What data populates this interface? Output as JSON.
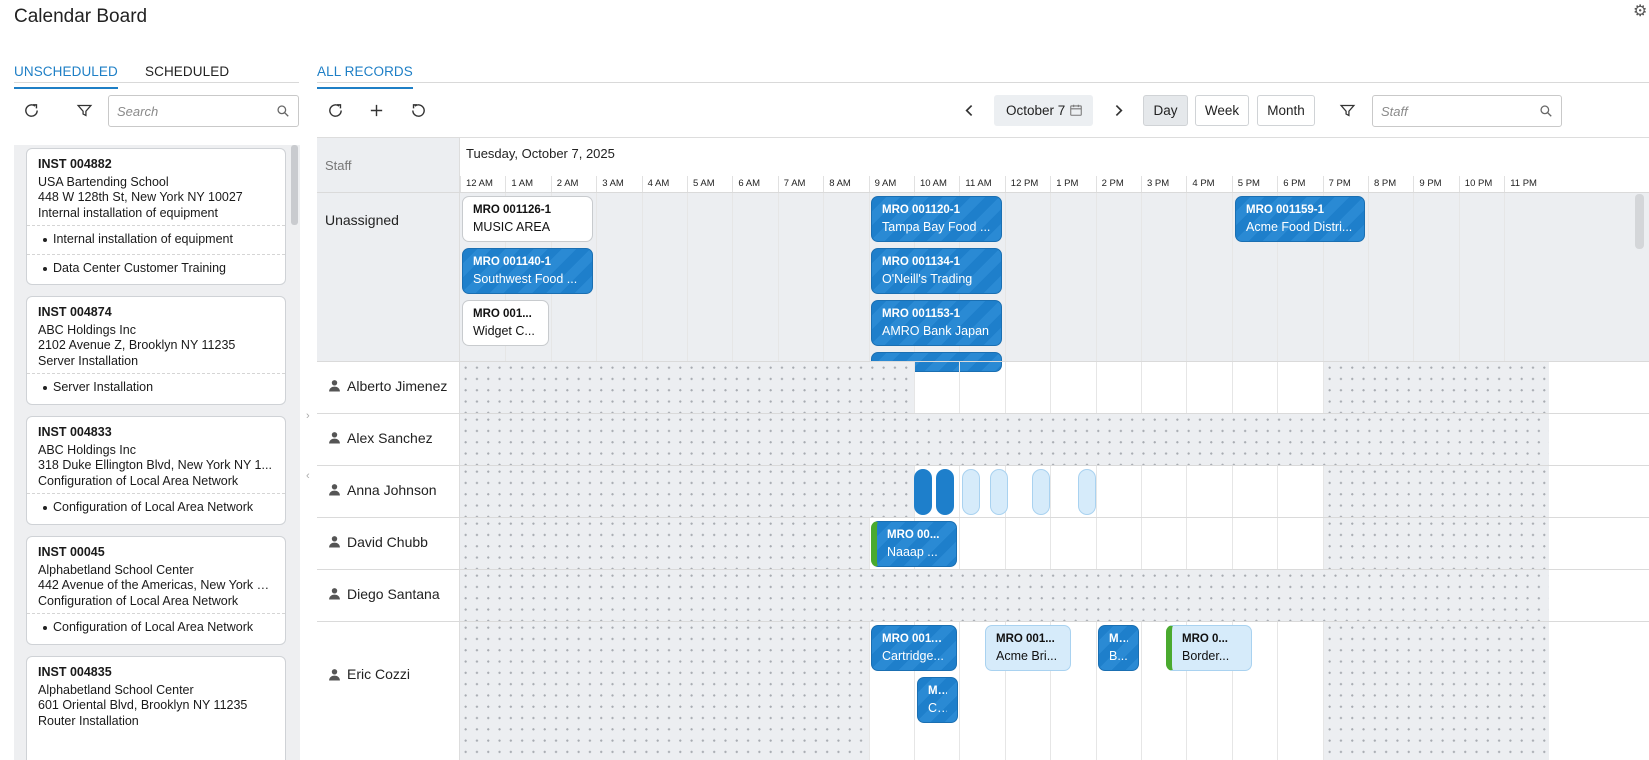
{
  "app": {
    "title": "Calendar Board"
  },
  "left": {
    "tabs": [
      {
        "label": "UNSCHEDULED"
      },
      {
        "label": "SCHEDULED"
      }
    ],
    "search_placeholder": "Search",
    "cards": [
      {
        "id": "INST 004882",
        "lines": [
          "USA Bartending School",
          "448 W 128th St, New York NY 10027",
          "Internal installation of equipment"
        ],
        "bullets": [
          "Internal installation of equipment",
          "Data Center Customer Training"
        ]
      },
      {
        "id": "INST 004874",
        "lines": [
          "ABC Holdings Inc",
          "2102 Avenue Z, Brooklyn NY 11235",
          "Server Installation"
        ],
        "bullets": [
          "Server Installation"
        ]
      },
      {
        "id": "INST 004833",
        "lines": [
          "ABC Holdings Inc",
          "318 Duke Ellington Blvd, New York NY 1...",
          "Configuration of Local Area Network"
        ],
        "bullets": [
          "Configuration of Local Area Network"
        ]
      },
      {
        "id": "INST 00045",
        "lines": [
          "Alphabetland School Center",
          "442 Avenue of the Americas, New York N...",
          "Configuration of Local Area Network"
        ],
        "bullets": [
          "Configuration of Local Area Network"
        ]
      },
      {
        "id": "INST 004835",
        "lines": [
          "Alphabetland School Center",
          "601 Oriental Blvd, Brooklyn NY 11235",
          "Router Installation"
        ],
        "bullets": []
      }
    ]
  },
  "right": {
    "tabs": [
      {
        "label": "ALL RECORDS"
      }
    ],
    "date_label": "October 7",
    "views": [
      {
        "label": "Day"
      },
      {
        "label": "Week"
      },
      {
        "label": "Month"
      }
    ],
    "staff_placeholder": "Staff",
    "staff_header": "Staff",
    "day_title": "Tuesday, October 7, 2025",
    "hours": [
      "12 AM",
      "1 AM",
      "2 AM",
      "3 AM",
      "4 AM",
      "5 AM",
      "6 AM",
      "7 AM",
      "8 AM",
      "9 AM",
      "10 AM",
      "11 AM",
      "12 PM",
      "1 PM",
      "2 PM",
      "3 PM",
      "4 PM",
      "5 PM",
      "6 PM",
      "7 PM",
      "8 PM",
      "9 PM",
      "10 PM",
      "11 PM"
    ],
    "rows": [
      {
        "name": "Unassigned"
      },
      {
        "name": "Alberto Jimenez"
      },
      {
        "name": "Alex Sanchez"
      },
      {
        "name": "Anna Johnson"
      },
      {
        "name": "David Chubb"
      },
      {
        "name": "Diego Santana"
      },
      {
        "name": "Eric Cozzi"
      }
    ],
    "events": {
      "u1": {
        "a": "MRO 001126-1",
        "b": "MUSIC AREA"
      },
      "u2": {
        "a": "MRO 001140-1",
        "b": "Southwest Food ..."
      },
      "u3": {
        "a": "MRO 001...",
        "b": "Widget C..."
      },
      "u4": {
        "a": "MRO 001120-1",
        "b": "Tampa Bay Food ..."
      },
      "u5": {
        "a": "MRO 001134-1",
        "b": "O'Neill's Trading"
      },
      "u6": {
        "a": "MRO 001153-1",
        "b": "AMRO Bank Japan"
      },
      "u7": {
        "a": "MRO 001159-1",
        "b": "Acme Food Distri..."
      },
      "d1": {
        "a": "MRO 00...",
        "b": "Naaap ..."
      },
      "e1": {
        "a": "MRO 0011...",
        "b": "Cartridge..."
      },
      "e2": {
        "a": "MRO 001...",
        "b": "Acme Bri..."
      },
      "e3": {
        "a": "M...",
        "b": "B..."
      },
      "e4": {
        "a": "MRO 0...",
        "b": "Border..."
      },
      "e5": {
        "a": "M...",
        "b": "C..."
      }
    }
  },
  "colors": {
    "accent": "#1e7fc6",
    "event_blue": "#1e7fcb",
    "event_light": "#d6ebfa",
    "green_marker": "#4aaa2f"
  }
}
